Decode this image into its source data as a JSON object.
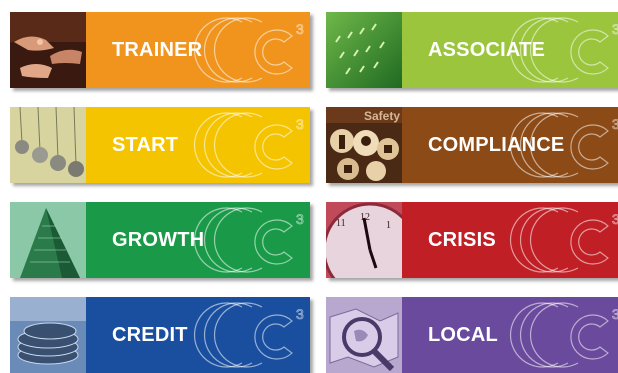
{
  "tiles": [
    {
      "label": "TRAINER",
      "color": "#f0941e",
      "thumb": "handshake"
    },
    {
      "label": "ASSOCIATE",
      "color": "#9bc53d",
      "thumb": "green-grass"
    },
    {
      "label": "START",
      "color": "#f5c400",
      "thumb": "pendulum"
    },
    {
      "label": "COMPLIANCE",
      "color": "#8b4a16",
      "thumb": "safety-signs"
    },
    {
      "label": "GROWTH",
      "color": "#1a9a48",
      "thumb": "skyscraper"
    },
    {
      "label": "CRISIS",
      "color": "#c01f26",
      "thumb": "clock"
    },
    {
      "label": "CREDIT",
      "color": "#1a4fa0",
      "thumb": "coins"
    },
    {
      "label": "LOCAL",
      "color": "#6a4a9c",
      "thumb": "magnifier-map"
    }
  ],
  "logo_mark": {
    "letter": "C",
    "superscript": "3"
  }
}
